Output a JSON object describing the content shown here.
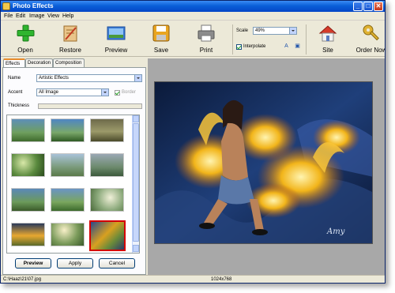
{
  "window": {
    "title": "Photo Effects",
    "controls": {
      "minimize": "_",
      "maximize": "□",
      "close": "✕"
    }
  },
  "menu": {
    "items": [
      "File",
      "Edit",
      "Image",
      "View",
      "Help"
    ]
  },
  "toolbar": {
    "buttons": [
      {
        "label": "Open",
        "icon": "green-plus-icon"
      },
      {
        "label": "Restore",
        "icon": "restore-icon"
      },
      {
        "label": "Preview",
        "icon": "preview-icon"
      },
      {
        "label": "Save",
        "icon": "floppy-disk-icon"
      },
      {
        "label": "Print",
        "icon": "printer-icon"
      },
      {
        "label": "Site",
        "icon": "home-icon"
      },
      {
        "label": "Order Now",
        "icon": "key-icon"
      }
    ],
    "scale": {
      "label": "Scale",
      "value": "49%"
    },
    "interpolate": {
      "label": "Interpolate",
      "checked": true
    }
  },
  "tabs": [
    "Effects",
    "Decoration",
    "Composition"
  ],
  "effects": {
    "name_label": "Name",
    "name_value": "Artistic Effects",
    "accent_label": "Accent",
    "accent_value": "All Image",
    "border_label": "Border",
    "border_checked": true,
    "thickness_label": "Thickness"
  },
  "thumbnails": {
    "selected_index": 11,
    "count": 12
  },
  "actions": {
    "preview": "Preview",
    "apply": "Apply",
    "cancel": "Cancel"
  },
  "canvas": {
    "signature": "Amy"
  },
  "status": {
    "path": "C:\\Haaz\\21\\07.jpg",
    "dimensions": "1024x768"
  },
  "colors": {
    "title_bar": "#0a5fd8",
    "selected_thumb_border": "#d40000",
    "canvas_bg": "#a8a8a8"
  }
}
